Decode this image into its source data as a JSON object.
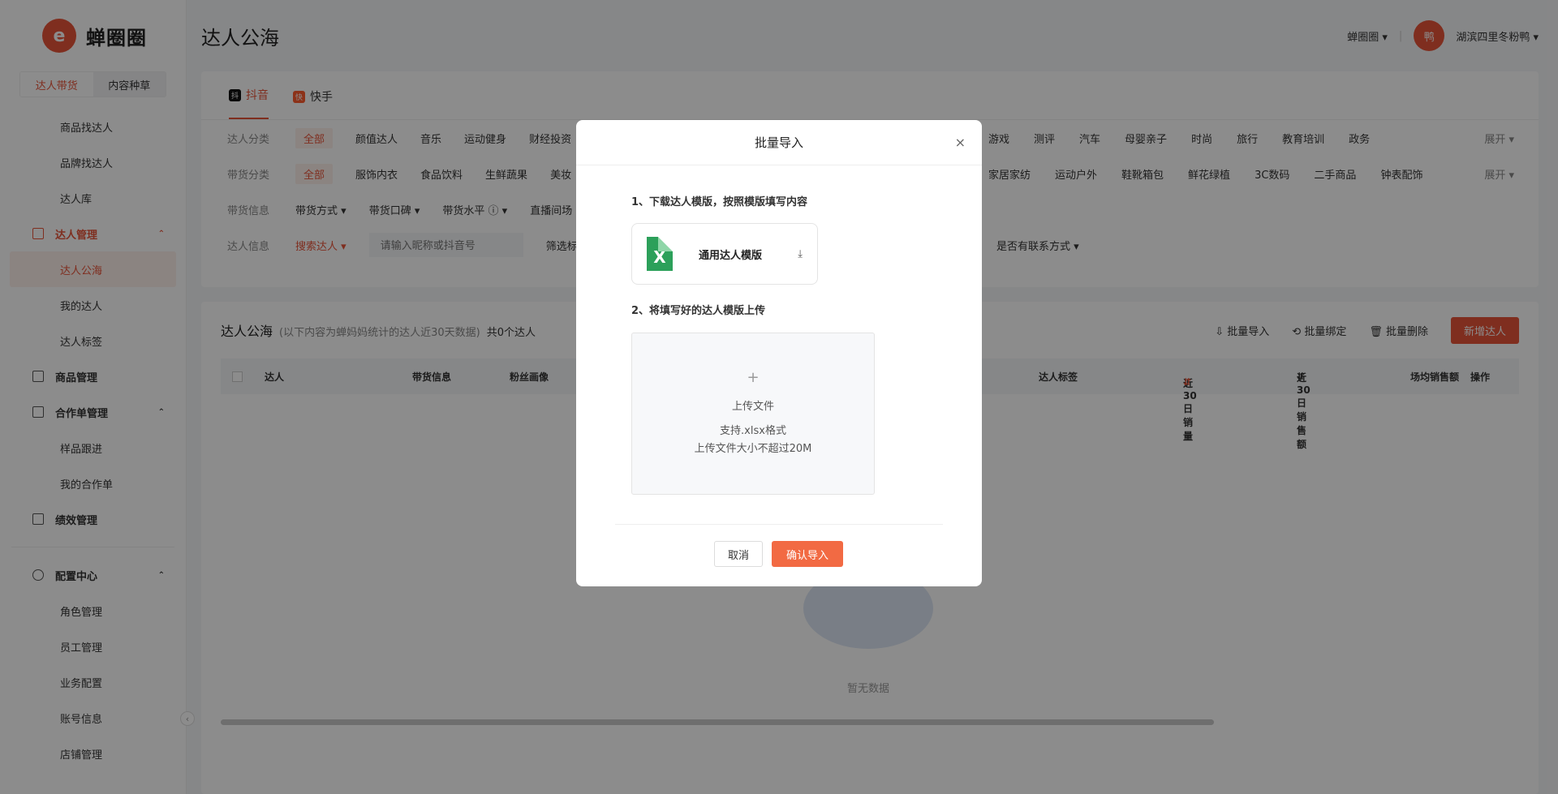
{
  "brand": {
    "name": "蝉圈圈",
    "logo_glyph": "e"
  },
  "sidebar": {
    "segments": [
      "达人带货",
      "内容种草"
    ],
    "items_top": [
      "商品找达人",
      "品牌找达人",
      "达人库"
    ],
    "group_talent": "达人管理",
    "talent_items": [
      "达人公海",
      "我的达人",
      "达人标签"
    ],
    "group_goods": "商品管理",
    "group_coop": "合作单管理",
    "coop_items": [
      "样品跟进",
      "我的合作单"
    ],
    "group_perf": "绩效管理",
    "group_config": "配置中心",
    "config_items": [
      "角色管理",
      "员工管理",
      "业务配置",
      "账号信息",
      "店铺管理"
    ],
    "collapse_glyph": "‹"
  },
  "header": {
    "title": "达人公海",
    "workspace": "蝉圈圈",
    "avatar_text": "鸭",
    "user_name": "湖滨四里冬粉鸭"
  },
  "platform_tabs": [
    {
      "label": "抖音",
      "icon": "抖"
    },
    {
      "label": "快手",
      "icon": "快"
    }
  ],
  "filters": {
    "category_label": "达人分类",
    "category_all": "全部",
    "category_items_left": [
      "颜值达人",
      "音乐",
      "运动健身",
      "财经投资"
    ],
    "category_items_right": [
      "游戏",
      "测评",
      "汽车",
      "母婴亲子",
      "时尚",
      "旅行",
      "教育培训",
      "政务"
    ],
    "goods_label": "带货分类",
    "goods_all": "全部",
    "goods_items_left": [
      "服饰内衣",
      "食品饮料",
      "生鲜蔬果",
      "美妆"
    ],
    "goods_items_right": [
      "家居家纺",
      "运动户外",
      "鞋靴箱包",
      "鲜花绿植",
      "3C数码",
      "二手商品",
      "钟表配饰"
    ],
    "expand": "展开",
    "info_label": "带货信息",
    "info_items": [
      "带货方式",
      "带货口碑",
      "带货水平",
      "直播间场"
    ],
    "talent_info_label": "达人信息",
    "search_select": "搜索达人",
    "search_placeholder": "请输入昵称或抖音号",
    "screen_label": "筛选标",
    "contact_filter": "是否有联系方式"
  },
  "list": {
    "title": "达人公海",
    "note": "(以下内容为蝉妈妈统计的达人近30天数据)",
    "count": "共0个达人",
    "actions": [
      "批量导入",
      "批量绑定",
      "批量删除"
    ],
    "add_button": "新增达人",
    "columns": [
      "达人",
      "带货信息",
      "粉丝画像",
      "达人标签",
      "近30日销量",
      "近30日销售额",
      "场均销售额",
      "操作"
    ],
    "empty_text": "暂无数据"
  },
  "modal": {
    "title": "批量导入",
    "close": "×",
    "step1": "1、下载达人模版，按照模版填写内容",
    "template_name": "通用达人模版",
    "step2": "2、将填写好的达人模版上传",
    "upload_plus": "+",
    "upload_title": "上传文件",
    "upload_format": "支持.xlsx格式",
    "upload_limit": "上传文件大小不超过20M",
    "cancel": "取消",
    "confirm": "确认导入"
  },
  "colors": {
    "accent": "#e8543a",
    "excel": "#2ca05a"
  }
}
